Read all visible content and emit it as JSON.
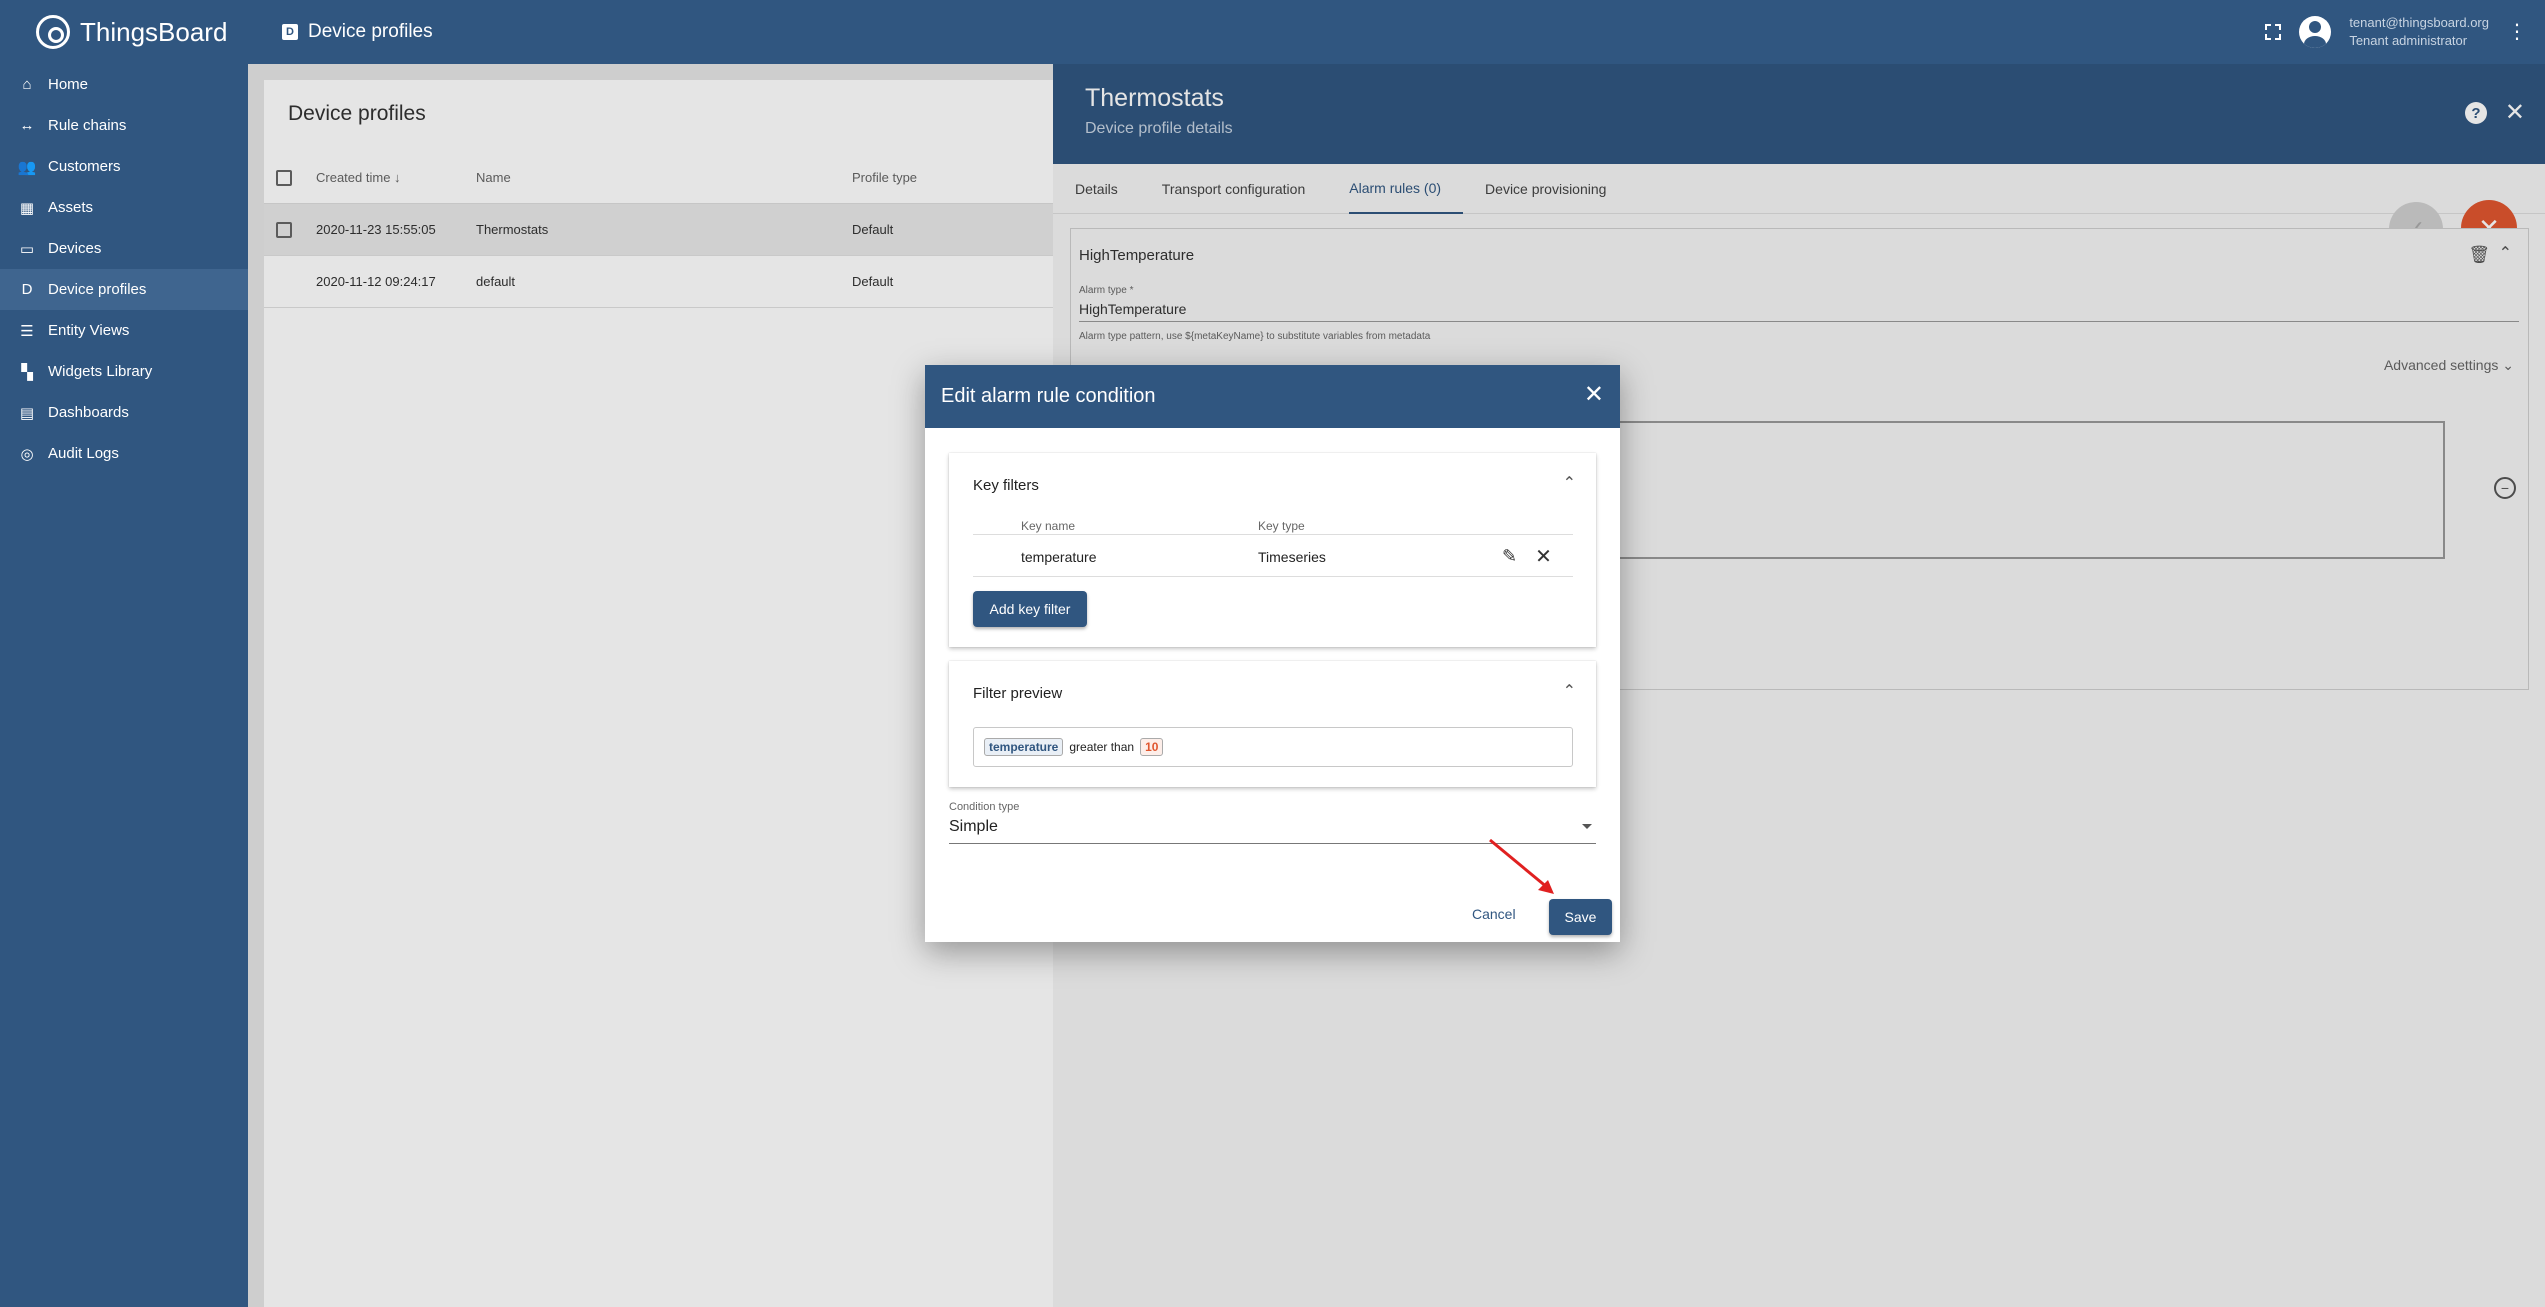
{
  "app": {
    "name": "ThingsBoard"
  },
  "sidebar": {
    "items": [
      {
        "label": "Home",
        "icon": "home-icon",
        "glyph": "⌂"
      },
      {
        "label": "Rule chains",
        "icon": "rule-chains-icon",
        "glyph": "↔"
      },
      {
        "label": "Customers",
        "icon": "customers-icon",
        "glyph": "👥"
      },
      {
        "label": "Assets",
        "icon": "assets-icon",
        "glyph": "▦"
      },
      {
        "label": "Devices",
        "icon": "devices-icon",
        "glyph": "▭"
      },
      {
        "label": "Device profiles",
        "icon": "device-profiles-icon",
        "glyph": "D",
        "active": true
      },
      {
        "label": "Entity Views",
        "icon": "entity-views-icon",
        "glyph": "☰"
      },
      {
        "label": "Widgets Library",
        "icon": "widgets-library-icon",
        "glyph": "▚"
      },
      {
        "label": "Dashboards",
        "icon": "dashboards-icon",
        "glyph": "▤"
      },
      {
        "label": "Audit Logs",
        "icon": "audit-logs-icon",
        "glyph": "◎"
      }
    ]
  },
  "topbar": {
    "breadcrumb": "Device profiles",
    "user_email": "tenant@thingsboard.org",
    "user_role": "Tenant administrator"
  },
  "list": {
    "title": "Device profiles",
    "columns": {
      "created": "Created time",
      "name": "Name",
      "type": "Profile type"
    },
    "rows": [
      {
        "created": "2020-11-23 15:55:05",
        "name": "Thermostats",
        "type": "Default"
      },
      {
        "created": "2020-11-12 09:24:17",
        "name": "default",
        "type": "Default"
      }
    ]
  },
  "details": {
    "title": "Thermostats",
    "subtitle": "Device profile details",
    "help": "?",
    "tabs": [
      "Details",
      "Transport configuration",
      "Alarm rules (0)",
      "Device provisioning"
    ],
    "rule_name": "HighTemperature",
    "alarm_type_label": "Alarm type *",
    "alarm_type_value": "HighTemperature",
    "alarm_type_hint": "Alarm type pattern, use ${metaKeyName} to substitute variables from metadata",
    "advanced": "Advanced settings"
  },
  "dialog": {
    "title": "Edit alarm rule condition",
    "key_filters": {
      "title": "Key filters",
      "col_name": "Key name",
      "col_type": "Key type",
      "rows": [
        {
          "name": "temperature",
          "type": "Timeseries"
        }
      ],
      "add_label": "Add key filter"
    },
    "preview": {
      "title": "Filter preview",
      "key": "temperature",
      "op": "greater than",
      "value": "10"
    },
    "condition_type": {
      "label": "Condition type",
      "value": "Simple"
    },
    "cancel_label": "Cancel",
    "save_label": "Save"
  },
  "colors": {
    "primary": "#305680",
    "accent": "#e0562f",
    "arrow": "#e02020"
  }
}
